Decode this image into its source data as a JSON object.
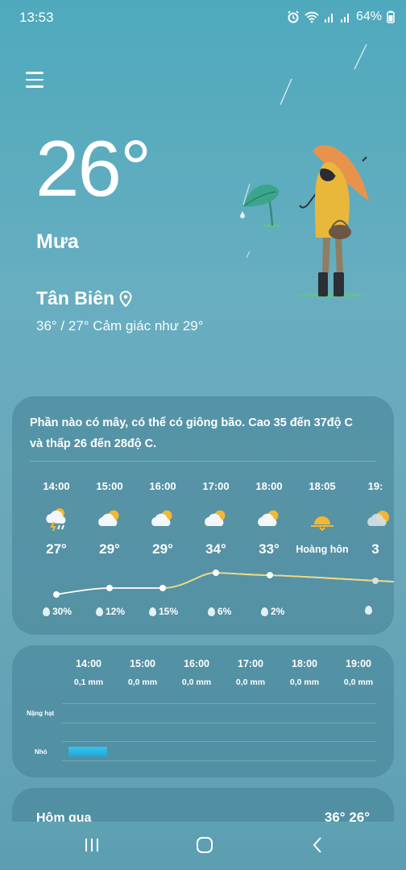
{
  "status": {
    "time": "13:53",
    "battery": "64%",
    "icons": [
      "alarm-icon",
      "wifi-icon",
      "signal-icon",
      "signal-icon",
      "battery-icon"
    ]
  },
  "current": {
    "temperature": "26°",
    "condition": "Mưa",
    "location": "Tân Biên",
    "high_low_feels": "36° / 27° Cảm giác như 29°"
  },
  "forecast": {
    "summary": "Phần nào có mây, có thể có giông bão. Cao 35 đến 37độ C và thấp 26 đến 28độ C.",
    "hours": [
      {
        "time": "14:00",
        "icon": "thunderstorm-rain-icon",
        "temp": "27°",
        "precip": "30%"
      },
      {
        "time": "15:00",
        "icon": "partly-cloudy-icon",
        "temp": "29°",
        "precip": "12%"
      },
      {
        "time": "16:00",
        "icon": "partly-cloudy-icon",
        "temp": "29°",
        "precip": "15%"
      },
      {
        "time": "17:00",
        "icon": "partly-cloudy-icon",
        "temp": "34°",
        "precip": "6%"
      },
      {
        "time": "18:00",
        "icon": "partly-cloudy-icon",
        "temp": "33°",
        "precip": "2%"
      },
      {
        "time": "18:05",
        "icon": "sunset-icon",
        "temp": "Hoàng hôn",
        "precip": ""
      },
      {
        "time": "19:",
        "icon": "moon-cloud-icon",
        "temp": "3",
        "precip": ""
      }
    ]
  },
  "rain": {
    "times": [
      "14:00",
      "15:00",
      "16:00",
      "17:00",
      "18:00",
      "19:00"
    ],
    "amounts": [
      "0,1 mm",
      "0,0 mm",
      "0,0 mm",
      "0,0 mm",
      "0,0 mm",
      "0,0 mm"
    ],
    "label_heavy": "Nặng hạt",
    "label_light": "Nhỏ"
  },
  "yesterday": {
    "label": "Hôm qua",
    "temps": "36°  26°"
  },
  "colors": {
    "sun": "#f5b731",
    "rain_bar": "#2db8e6",
    "umbrella": "#e8934b",
    "coat": "#e9b83a"
  }
}
